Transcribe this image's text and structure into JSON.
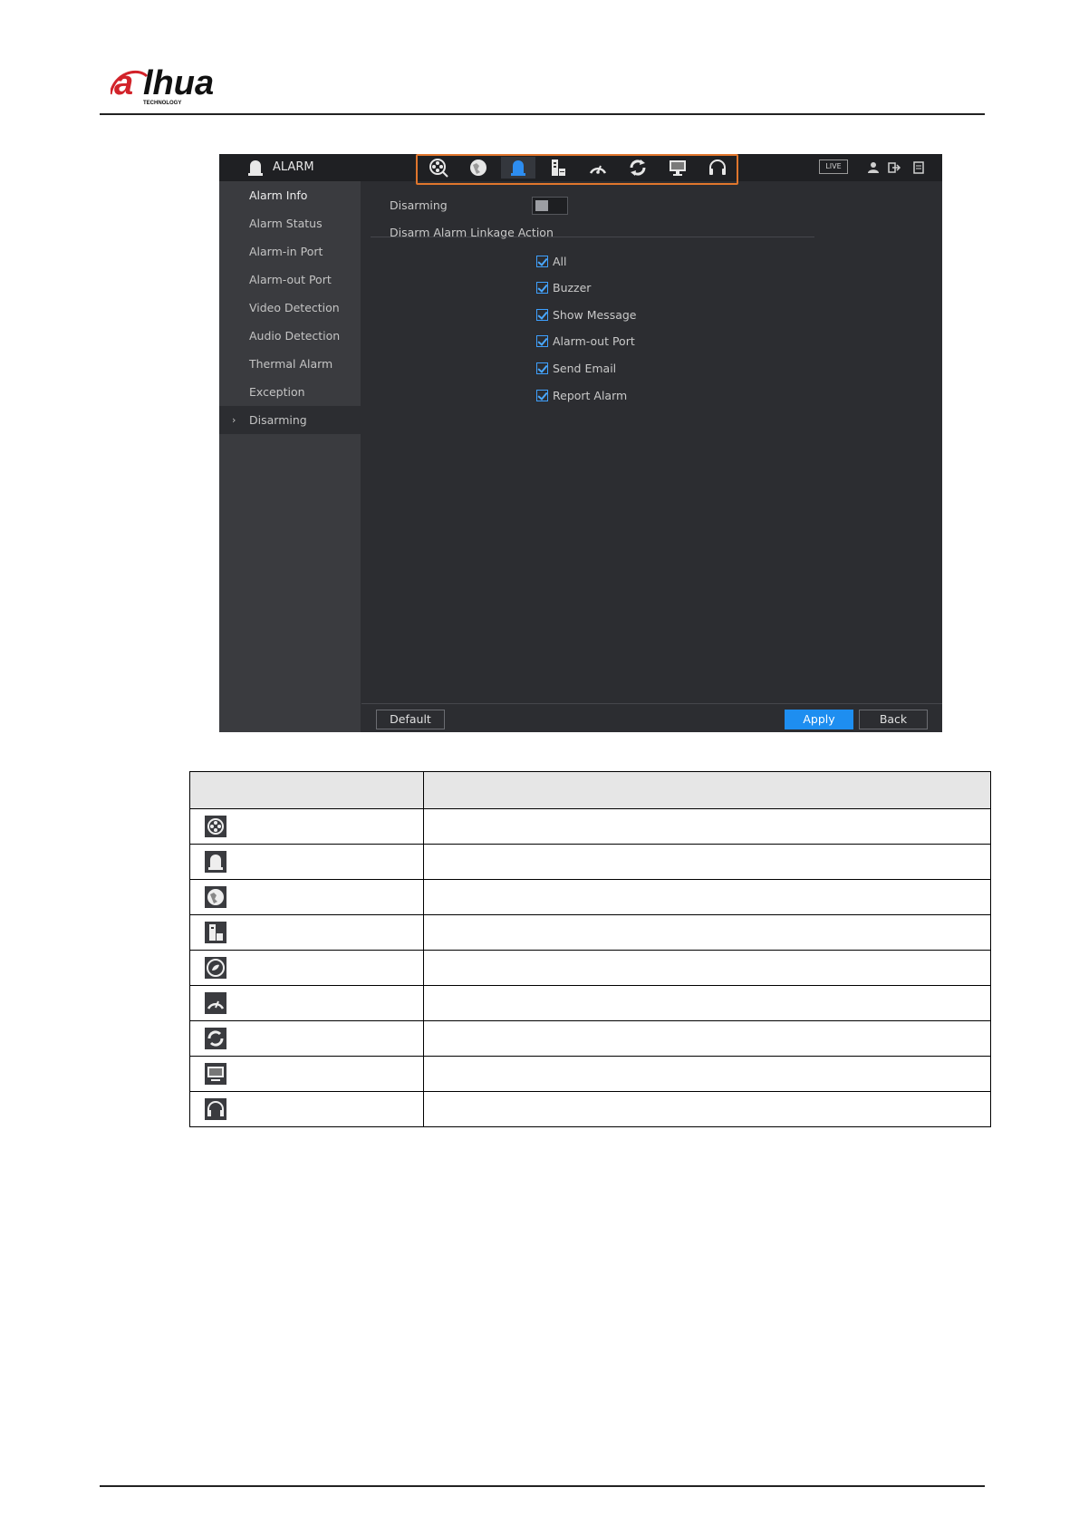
{
  "header": {
    "logo_text": "alhua",
    "logo_subtext": "TECHNOLOGY"
  },
  "window": {
    "title": "ALARM",
    "title_icon": "alarm-bell-icon",
    "toolbar_icons": [
      "search-icon",
      "network-icon",
      "alarm-bell-icon",
      "storage-icon",
      "system-info-icon",
      "maintenance-icon",
      "display-icon",
      "audio-icon"
    ],
    "active_toolbar_icon": "alarm-bell-icon",
    "live_label": "LIVE",
    "top_right_icons": [
      "user-icon",
      "logout-icon",
      "fullscreen-icon"
    ]
  },
  "sidebar": {
    "header": "Alarm Info",
    "items": [
      {
        "label": "Alarm Status"
      },
      {
        "label": "Alarm-in Port"
      },
      {
        "label": "Alarm-out Port"
      },
      {
        "label": "Video Detection"
      },
      {
        "label": "Audio Detection"
      },
      {
        "label": "Thermal Alarm"
      },
      {
        "label": "Exception"
      },
      {
        "label": "Disarming"
      }
    ],
    "selected": "Disarming",
    "selected_marker": "›"
  },
  "main": {
    "disarming_label": "Disarming",
    "disarming_enabled": false,
    "linkage_title": "Disarm Alarm Linkage Action",
    "actions": [
      {
        "label": "All",
        "checked": true
      },
      {
        "label": "Buzzer",
        "checked": true
      },
      {
        "label": "Show Message",
        "checked": true
      },
      {
        "label": "Alarm-out Port",
        "checked": true
      },
      {
        "label": "Send Email",
        "checked": true
      },
      {
        "label": "Report Alarm",
        "checked": true
      }
    ]
  },
  "footer": {
    "default_label": "Default",
    "apply_label": "Apply",
    "back_label": "Back"
  },
  "icon_table": {
    "header": [
      "",
      ""
    ],
    "rows": [
      {
        "icon": "search-icon",
        "description": ""
      },
      {
        "icon": "alarm-bell-icon",
        "description": ""
      },
      {
        "icon": "network-icon",
        "description": ""
      },
      {
        "icon": "storage-icon",
        "description": ""
      },
      {
        "icon": "account-icon",
        "description": ""
      },
      {
        "icon": "system-info-icon",
        "description": ""
      },
      {
        "icon": "maintenance-icon",
        "description": ""
      },
      {
        "icon": "display-icon",
        "description": ""
      },
      {
        "icon": "audio-icon",
        "description": ""
      }
    ]
  },
  "colors": {
    "accent_blue": "#1e8ef0",
    "highlight_orange": "#e0762d",
    "logo_red": "#d2232a"
  }
}
